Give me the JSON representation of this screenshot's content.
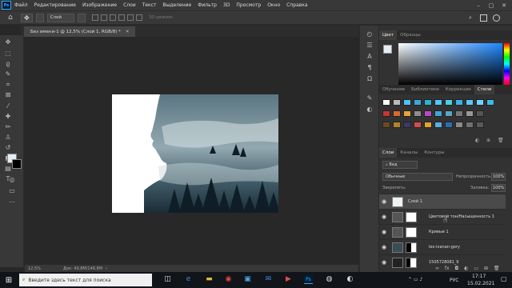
{
  "menubar": {
    "app_icon": "Ps",
    "items": [
      "Файл",
      "Редактирование",
      "Изображение",
      "Слои",
      "Текст",
      "Выделение",
      "Фильтр",
      "3D",
      "Просмотр",
      "Окно",
      "Справка"
    ]
  },
  "options": {
    "layer_select": "Слой",
    "mode_3d": "3D-режим:"
  },
  "document": {
    "tab_title": "Без имени-1 @ 12,5% (Слой 1, RGB/8) *"
  },
  "status": {
    "zoom": "12,5%",
    "doc_size": "Док: 49,8M/148,8M"
  },
  "color_panel": {
    "tabs": [
      "Цвет",
      "Образцы"
    ],
    "fg_color": "#e3edf3",
    "bg_color": "#000000"
  },
  "learn_panel": {
    "tabs": [
      "Обучение",
      "Библиотеки",
      "Коррекции",
      "Стили"
    ]
  },
  "layers_panel": {
    "tabs": [
      "Слои",
      "Каналы",
      "Контуры"
    ],
    "filter_kind": "Вид",
    "blend_mode": "Обычные",
    "opacity_label": "Непрозрачность:",
    "opacity_value": "100%",
    "lock_label": "Закрепить:",
    "fill_label": "Заливка:",
    "fill_value": "100%",
    "layers": [
      {
        "name": "Слой 1",
        "selected": true
      },
      {
        "name": "Цветовой тон/Насыщенность 1",
        "selected": false
      },
      {
        "name": "Кривые 1",
        "selected": false
      },
      {
        "name": "lex-ivanan-gory",
        "selected": false
      },
      {
        "name": "1505728081_9",
        "selected": false
      }
    ]
  },
  "taskbar": {
    "search_placeholder": "Введите здесь текст для поиска",
    "lang": "РУС",
    "time": "17:17",
    "date": "15.02.2021"
  },
  "colors": {
    "accent": "#31a8ff",
    "ui_dark": "#383838",
    "canvas_bg": "#282828"
  }
}
